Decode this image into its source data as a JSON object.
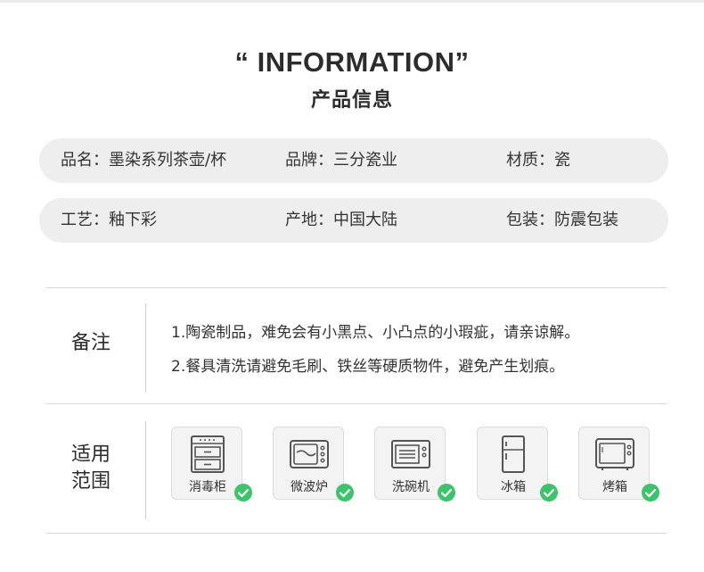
{
  "header": {
    "title_en": "“ INFORMATION”",
    "title_cn": "产品信息"
  },
  "info": {
    "row1": [
      "品名：墨染系列茶壶/杯",
      "品牌：三分瓷业",
      "材质：瓷"
    ],
    "row2": [
      "工艺：釉下彩",
      "产地：中国大陆",
      "包装：防震包装"
    ]
  },
  "notes": {
    "label": "备注",
    "lines": [
      "1.陶瓷制品，难免会有小黑点、小凸点的小瑕疵，请亲谅解。",
      "2.餐具清洗请避免毛刷、铁丝等硬质物件，避免产生划痕。"
    ]
  },
  "usage": {
    "label_line1": "适用",
    "label_line2": "范围",
    "items": [
      {
        "label": "消毒柜",
        "icon": "sterilizer-icon"
      },
      {
        "label": "微波炉",
        "icon": "microwave-icon"
      },
      {
        "label": "洗碗机",
        "icon": "dishwasher-icon"
      },
      {
        "label": "冰箱",
        "icon": "fridge-icon"
      },
      {
        "label": "烤箱",
        "icon": "oven-icon"
      }
    ],
    "check_color": "#3cc36b",
    "icon_color": "#555555"
  }
}
